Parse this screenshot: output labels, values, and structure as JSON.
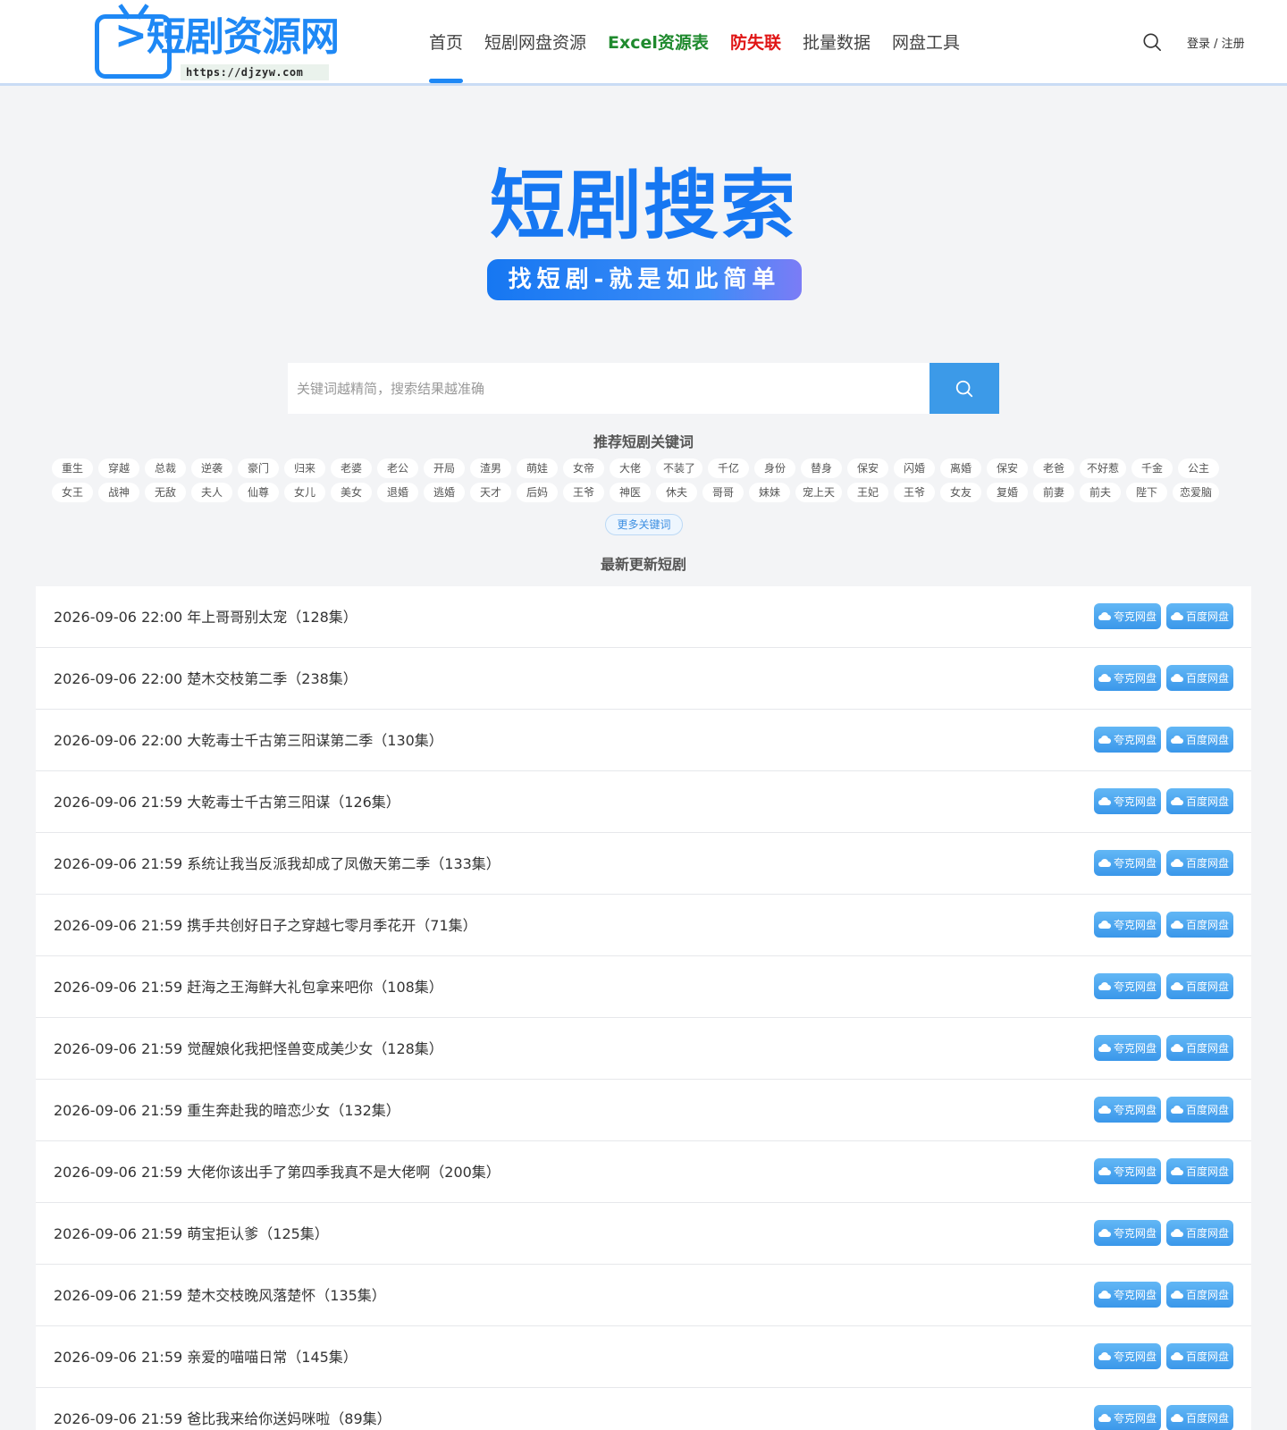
{
  "logo": {
    "text": "短剧资源网",
    "url": "https://djzyw.com"
  },
  "nav": [
    {
      "label": "首页",
      "active": true,
      "color": "#444444",
      "bold": false
    },
    {
      "label": "短剧网盘资源",
      "active": false,
      "color": "#444444",
      "bold": false
    },
    {
      "label": "Excel资源表",
      "active": false,
      "color": "#1f8a2e",
      "bold": true
    },
    {
      "label": "防失联",
      "active": false,
      "color": "#e01515",
      "bold": true
    },
    {
      "label": "批量数据",
      "active": false,
      "color": "#444444",
      "bold": false
    },
    {
      "label": "网盘工具",
      "active": false,
      "color": "#444444",
      "bold": false
    }
  ],
  "header": {
    "search_icon": "search-icon",
    "login_label": "登录 / 注册"
  },
  "hero": {
    "title": "短剧搜索",
    "subtitle": "找短剧-就是如此简单"
  },
  "search": {
    "placeholder": "关键词越精简，搜索结果越准确",
    "value": "",
    "button_icon": "search-icon"
  },
  "keywords": {
    "title": "推荐短剧关键词",
    "row1": [
      "重生",
      "穿越",
      "总裁",
      "逆袭",
      "豪门",
      "归来",
      "老婆",
      "老公",
      "开局",
      "渣男",
      "萌娃",
      "女帝",
      "大佬",
      "不装了",
      "千亿",
      "身份",
      "替身",
      "保安",
      "闪婚",
      "离婚",
      "保安",
      "老爸",
      "不好惹",
      "千金",
      "公主"
    ],
    "row2": [
      "女王",
      "战神",
      "无敌",
      "夫人",
      "仙尊",
      "女儿",
      "美女",
      "退婚",
      "逃婚",
      "天才",
      "后妈",
      "王爷",
      "神医",
      "休夫",
      "哥哥",
      "妹妹",
      "宠上天",
      "王妃",
      "王爷",
      "女友",
      "复婚",
      "前妻",
      "前夫",
      "陛下",
      "恋爱脑"
    ],
    "more_label": "更多关键词"
  },
  "latest": {
    "title": "最新更新短剧",
    "btn_quark": "夸克网盘",
    "btn_baidu": "百度网盘",
    "items": [
      "2026-09-06 22:00 年上哥哥别太宠（128集）",
      "2026-09-06 22:00 楚木交枝第二季（238集）",
      "2026-09-06 22:00 大乾毒士千古第三阳谋第二季（130集）",
      "2026-09-06 21:59 大乾毒士千古第三阳谋（126集）",
      "2026-09-06 21:59 系统让我当反派我却成了凤傲天第二季（133集）",
      "2026-09-06 21:59 携手共创好日子之穿越七零月季花开（71集）",
      "2026-09-06 21:59 赶海之王海鲜大礼包拿来吧你（108集）",
      "2026-09-06 21:59 觉醒娘化我把怪兽变成美少女（128集）",
      "2026-09-06 21:59 重生奔赴我的暗恋少女（132集）",
      "2026-09-06 21:59 大佬你该出手了第四季我真不是大佬啊（200集）",
      "2026-09-06 21:59 萌宝拒认爹（125集）",
      "2026-09-06 21:59 楚木交枝晚风落楚怀（135集）",
      "2026-09-06 21:59 亲爱的喵喵日常（145集）",
      "2026-09-06 21:59 爸比我来给你送妈咪啦（89集）"
    ]
  },
  "colors": {
    "brand": "#1677f2",
    "search_button": "#3c9ae8",
    "excel": "#1f8a2e",
    "warning": "#e01515"
  }
}
